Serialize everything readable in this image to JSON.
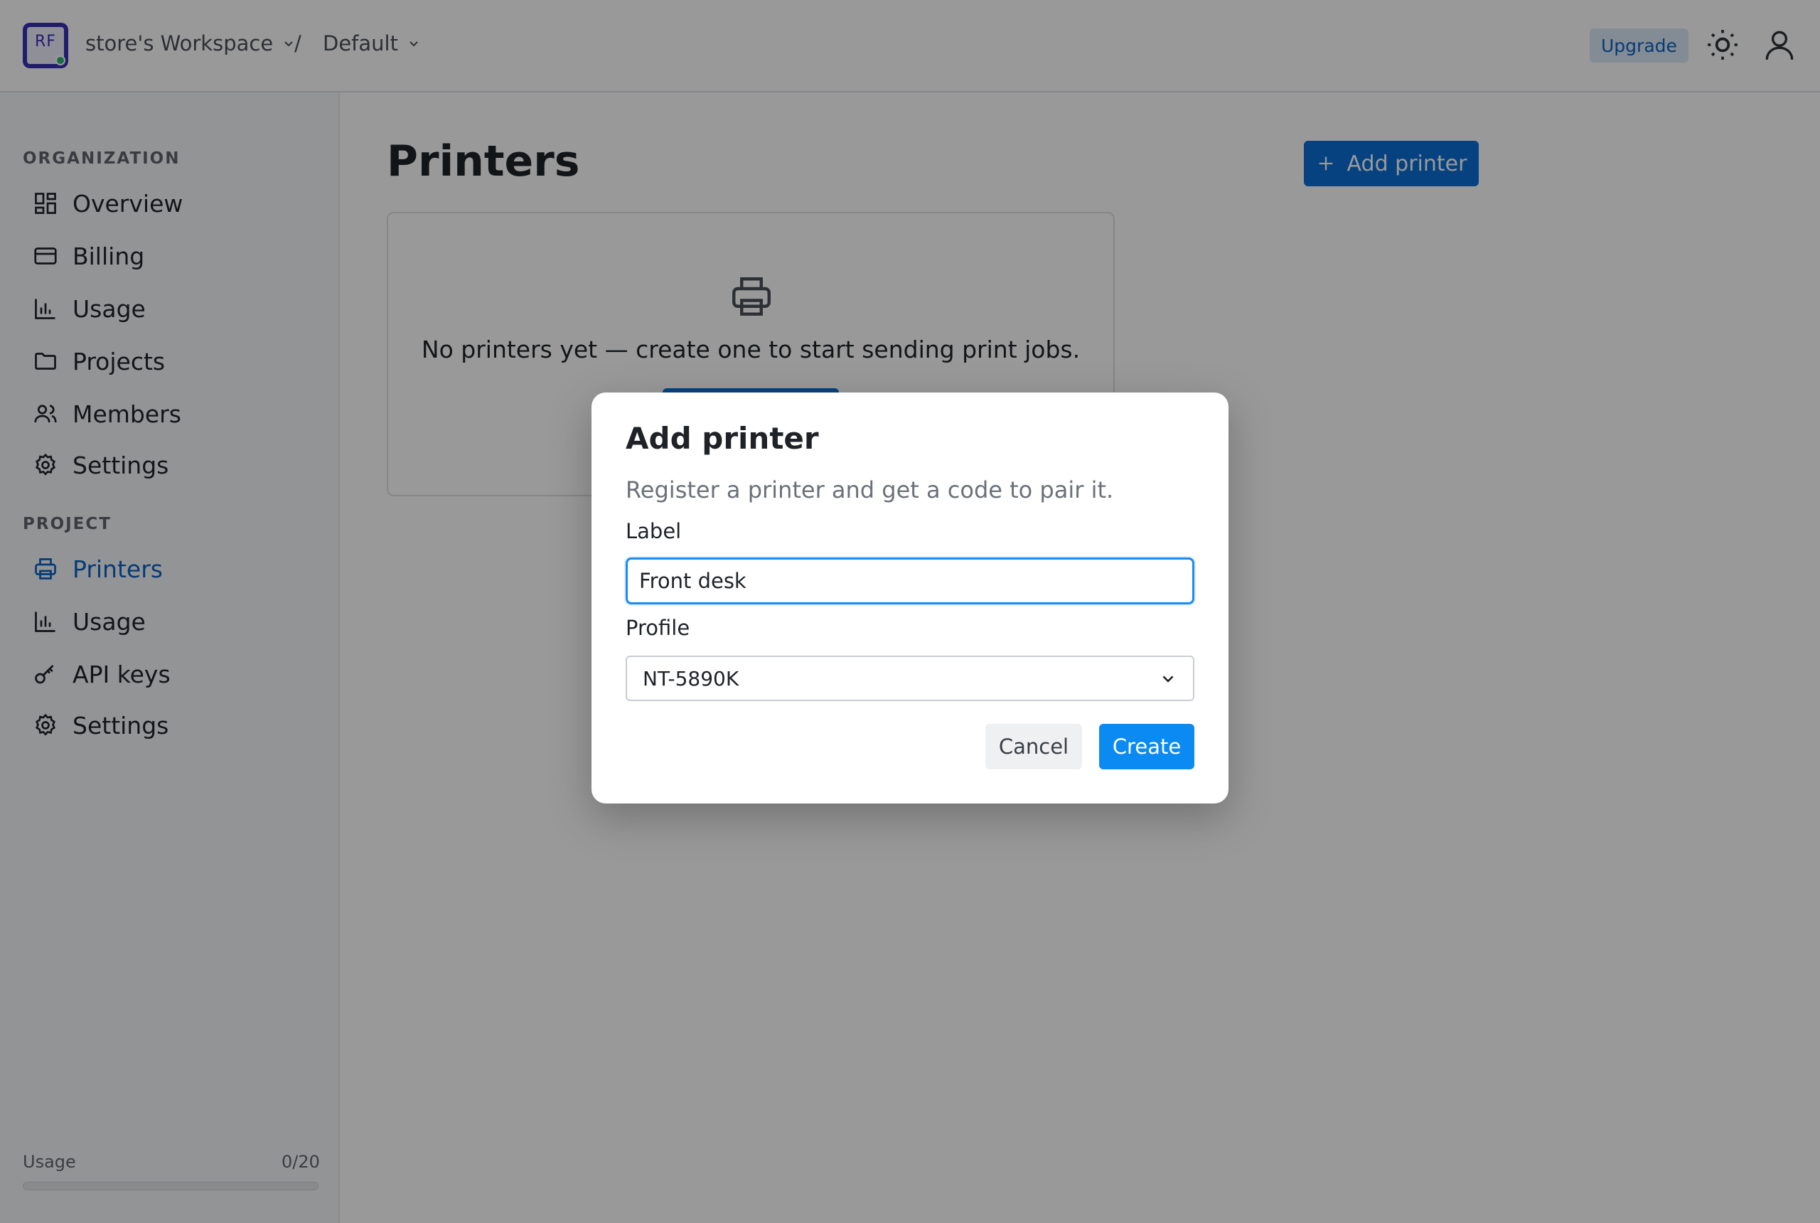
{
  "header": {
    "logo_text": "RF",
    "workspace": "store's Workspace",
    "separator": "/",
    "project": "Default",
    "upgrade_label": "Upgrade"
  },
  "sidebar": {
    "organization_title": "ORGANIZATION",
    "organization_items": [
      {
        "label": "Overview",
        "icon": "grid-icon"
      },
      {
        "label": "Billing",
        "icon": "credit-card-icon"
      },
      {
        "label": "Usage",
        "icon": "bar-chart-icon"
      },
      {
        "label": "Projects",
        "icon": "folder-icon"
      },
      {
        "label": "Members",
        "icon": "users-icon"
      },
      {
        "label": "Settings",
        "icon": "gear-icon"
      }
    ],
    "project_title": "PROJECT",
    "project_items": [
      {
        "label": "Printers",
        "icon": "printer-icon",
        "active": true
      },
      {
        "label": "Usage",
        "icon": "bar-chart-icon"
      },
      {
        "label": "API keys",
        "icon": "key-icon"
      },
      {
        "label": "Settings",
        "icon": "gear-icon"
      }
    ],
    "usage": {
      "label": "Usage",
      "count": "0/20",
      "fraction": 0
    }
  },
  "main": {
    "title": "Printers",
    "add_button": "Add printer",
    "empty_text": "No printers yet — create one to start sending print jobs."
  },
  "modal": {
    "title": "Add printer",
    "description": "Register a printer and get a code to pair it.",
    "label_field": {
      "label": "Label",
      "value": "Front desk"
    },
    "profile_field": {
      "label": "Profile",
      "value": "NT-5890K"
    },
    "cancel": "Cancel",
    "create": "Create"
  },
  "colors": {
    "accent": "#0b6fd6",
    "active_nav": "#0b63c4",
    "focus": "#1d8cf0",
    "overlay": "rgba(0,0,0,0.40)"
  }
}
